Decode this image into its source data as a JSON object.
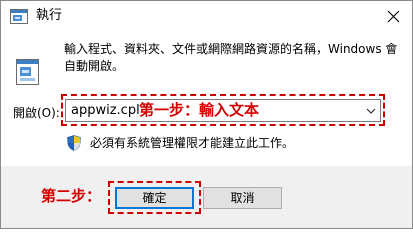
{
  "window": {
    "title": "執行"
  },
  "dialog": {
    "description": "輸入程式、資料夾、文件或網際網路資源的名稱，Windows 會自動開啟。",
    "open_label": "開啟(O):",
    "open_value": "appwiz.cpl",
    "admin_note": "必須有系統管理權限才能建立此工作。"
  },
  "annotations": {
    "step1": "第一步：輸入文本",
    "step2": "第二步：",
    "color": "#d40000"
  },
  "buttons": {
    "ok": "確定",
    "cancel": "取消"
  },
  "icons": {
    "app": "run-app-icon",
    "run": "run-program-icon",
    "shield": "uac-shield-icon",
    "close": "close-icon",
    "dropdown": "chevron-down-icon"
  }
}
